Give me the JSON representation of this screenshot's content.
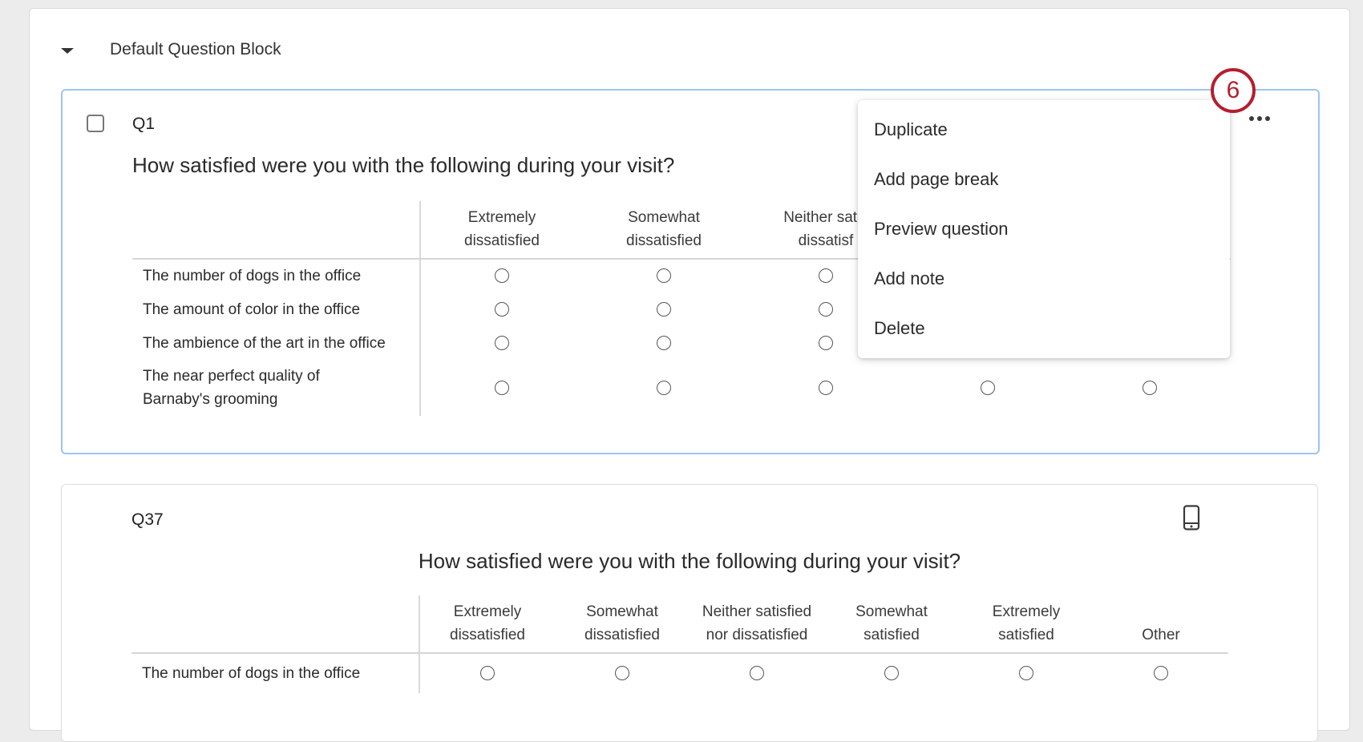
{
  "block": {
    "title": "Default Question Block"
  },
  "q1": {
    "number": "Q1",
    "text": "How satisfied were you with the following during your visit?",
    "columns": [
      [
        "Extremely",
        "dissatisfied"
      ],
      [
        "Somewhat",
        "dissatisfied"
      ],
      [
        "Neither satis",
        "dissatisf"
      ]
    ],
    "rows": [
      [
        "The number of dogs in the office"
      ],
      [
        "The amount of color in the office"
      ],
      [
        "The ambience of the art in the office"
      ],
      [
        "The near perfect quality of",
        "Barnaby's grooming"
      ]
    ]
  },
  "menu": {
    "items": [
      "Duplicate",
      "Add page break",
      "Preview question",
      "Add note",
      "Delete"
    ]
  },
  "step_badge": "6",
  "q37": {
    "number": "Q37",
    "text": "How satisfied were you with the following during your visit?",
    "columns": [
      [
        "Extremely",
        "dissatisfied"
      ],
      [
        "Somewhat",
        "dissatisfied"
      ],
      [
        "Neither satisfied",
        "nor dissatisfied"
      ],
      [
        "Somewhat",
        "satisfied"
      ],
      [
        "Extremely",
        "satisfied"
      ],
      [
        "",
        "Other"
      ]
    ],
    "rows": [
      [
        "The number of dogs in the office"
      ]
    ]
  },
  "icons": {
    "collapse": "caret-down-icon",
    "more": "more-options-icon",
    "mobile": "mobile-preview-icon"
  }
}
